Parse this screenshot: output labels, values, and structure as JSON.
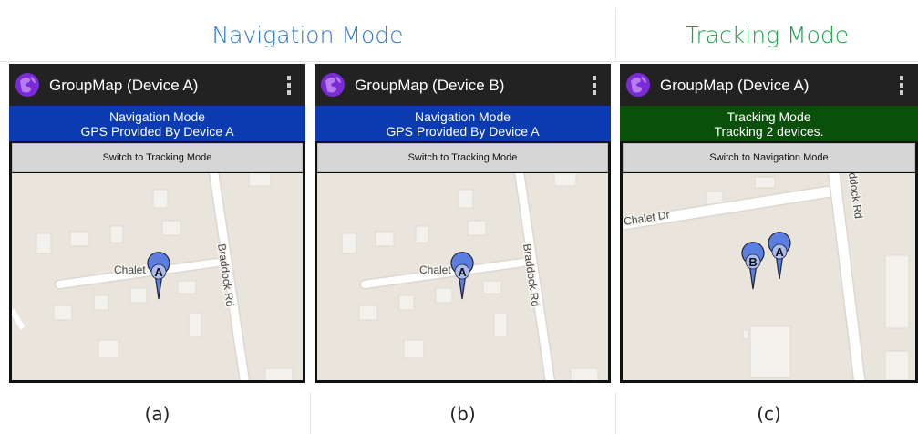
{
  "headers": {
    "navigation": {
      "text": "Navigation Mode",
      "color": "#2b78c6"
    },
    "tracking": {
      "text": "Tracking Mode",
      "color": "#16a34a"
    }
  },
  "panels": [
    {
      "caption": "(a)",
      "app_title": "GroupMap (Device A)",
      "banner": {
        "line1": "Navigation Mode",
        "line2": "GPS Provided By Device A",
        "color": "#0a3bb0"
      },
      "switch_label": "Switch to Tracking Mode",
      "map": {
        "street_labels": [
          "Chalet",
          "Braddock Rd"
        ],
        "markers": [
          "A"
        ]
      }
    },
    {
      "caption": "(b)",
      "app_title": "GroupMap (Device B)",
      "banner": {
        "line1": "Navigation Mode",
        "line2": "GPS Provided By Device A",
        "color": "#0a3bb0"
      },
      "switch_label": "Switch to Tracking Mode",
      "map": {
        "street_labels": [
          "Chalet",
          "Braddock Rd"
        ],
        "markers": [
          "A"
        ]
      }
    },
    {
      "caption": "(c)",
      "app_title": "GroupMap (Device A)",
      "banner": {
        "line1": "Tracking Mode",
        "line2": "Tracking 2 devices.",
        "color": "#0a4f0a"
      },
      "switch_label": "Switch to Navigation Mode",
      "map": {
        "street_labels": [
          "Chalet Dr",
          "ddock Rd"
        ],
        "markers": [
          "B",
          "A"
        ]
      }
    }
  ],
  "icons": {
    "app": "globe-app-icon",
    "menu": "overflow-menu-icon",
    "marker": "map-pin-icon"
  },
  "colors": {
    "marker_fill": "#5b7fe0",
    "map_bg": "#e9e5dc",
    "road": "#ffffff"
  }
}
